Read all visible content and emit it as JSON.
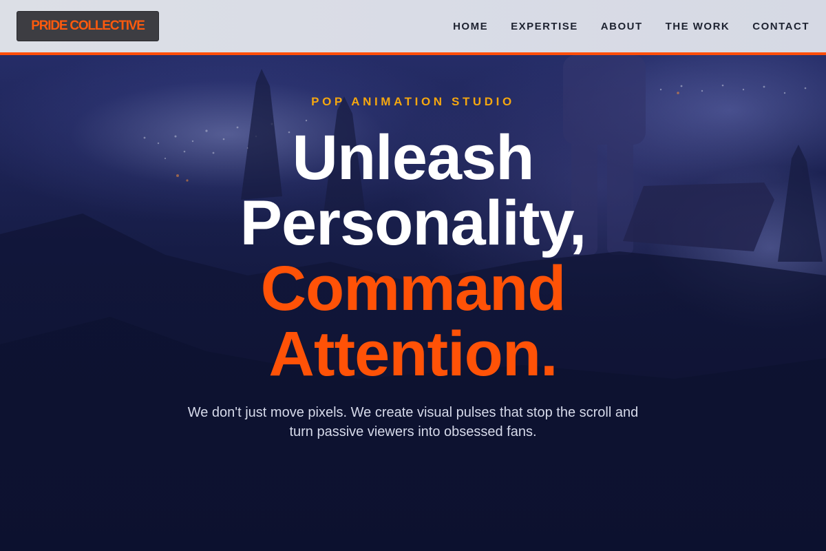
{
  "header": {
    "logo": "PRIDE COLLECTIVE",
    "nav": [
      {
        "label": "HOME"
      },
      {
        "label": "EXPERTISE"
      },
      {
        "label": "ABOUT"
      },
      {
        "label": "THE WORK"
      },
      {
        "label": "CONTACT"
      }
    ]
  },
  "hero": {
    "eyebrow": "POP ANIMATION STUDIO",
    "headline": {
      "line1": "Unleash",
      "line2": "Personality,",
      "line3": "Command",
      "line4": "Attention."
    },
    "subtext": "We don't just move pixels. We create visual pulses that stop the scroll and turn passive viewers into obsessed fans."
  },
  "colors": {
    "accent": "#ff5207",
    "eyebrow": "#f5a70f",
    "header_bg": "#dcdfe6",
    "hero_bg": "#141a3f"
  }
}
